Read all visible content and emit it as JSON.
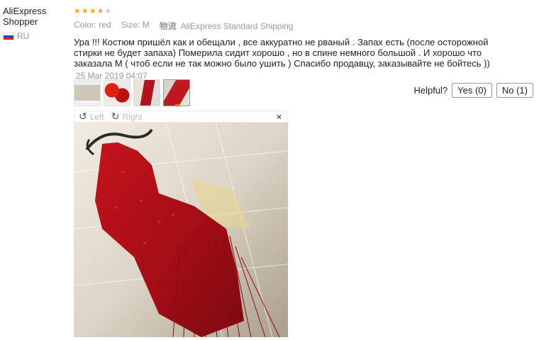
{
  "user": {
    "name": "AliExpress Shopper",
    "country": "RU"
  },
  "rating": {
    "value": 4,
    "max": 5,
    "on_color": "#f5a623",
    "off_color": "#cccccc"
  },
  "meta": {
    "color": "Color: red",
    "size": "Size: M",
    "shipping_label": "物流",
    "shipping": "AliExpress Standard Shipping"
  },
  "review": {
    "text": "Ура !!! Костюм пришёл как и обещали , все аккуратно не рваный . Запах есть (после осторожной стирки не будет запаха) Померила сидит хорошо , но в спине немного большой . И хорошо что заказала М ( чтоб если не так можно было ушить ) Спасибо продавцу, заказывайте не бойтесь ))",
    "date": "25 Mar 2019 04:07"
  },
  "helpful": {
    "label": "Helpful?",
    "yes": "Yes (0)",
    "no": "No (1)"
  },
  "viewer": {
    "rotate_left": "Left",
    "rotate_right": "Right",
    "close": "×"
  },
  "icons": {
    "rotate_left": "rotate-left-icon",
    "rotate_right": "rotate-right-icon",
    "close": "close-icon",
    "flag": "russia-flag-icon"
  }
}
